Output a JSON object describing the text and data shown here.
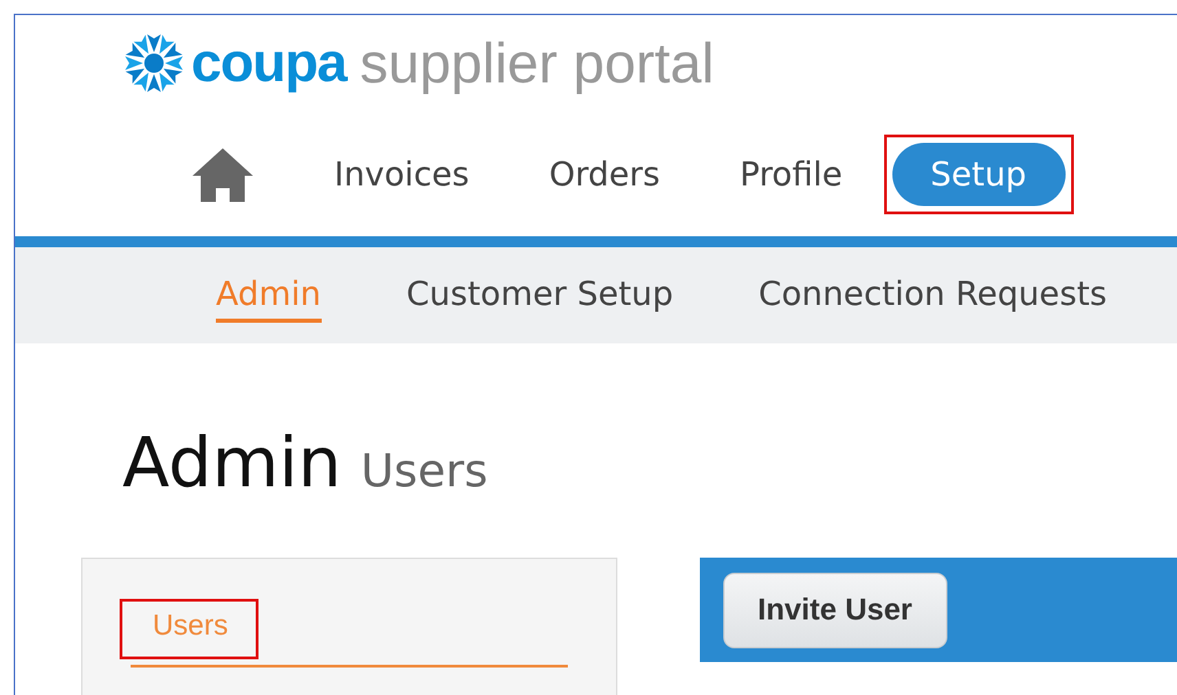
{
  "logo": {
    "brand": "coupa",
    "product": "supplier portal"
  },
  "nav": {
    "tabs": [
      {
        "label": "Invoices",
        "selected": false,
        "highlighted": false
      },
      {
        "label": "Orders",
        "selected": false,
        "highlighted": false
      },
      {
        "label": "Profile",
        "selected": false,
        "highlighted": false
      },
      {
        "label": "Setup",
        "selected": true,
        "highlighted": true
      }
    ]
  },
  "subnav": {
    "tabs": [
      {
        "label": "Admin",
        "selected": true
      },
      {
        "label": "Customer Setup",
        "selected": false
      },
      {
        "label": "Connection Requests",
        "selected": false
      }
    ]
  },
  "heading": {
    "title": "Admin",
    "subtitle": "Users"
  },
  "sidebar": {
    "items": [
      {
        "label": "Users",
        "selected": true,
        "highlighted": true
      }
    ]
  },
  "toolbar": {
    "buttons": [
      "Invite User"
    ]
  }
}
